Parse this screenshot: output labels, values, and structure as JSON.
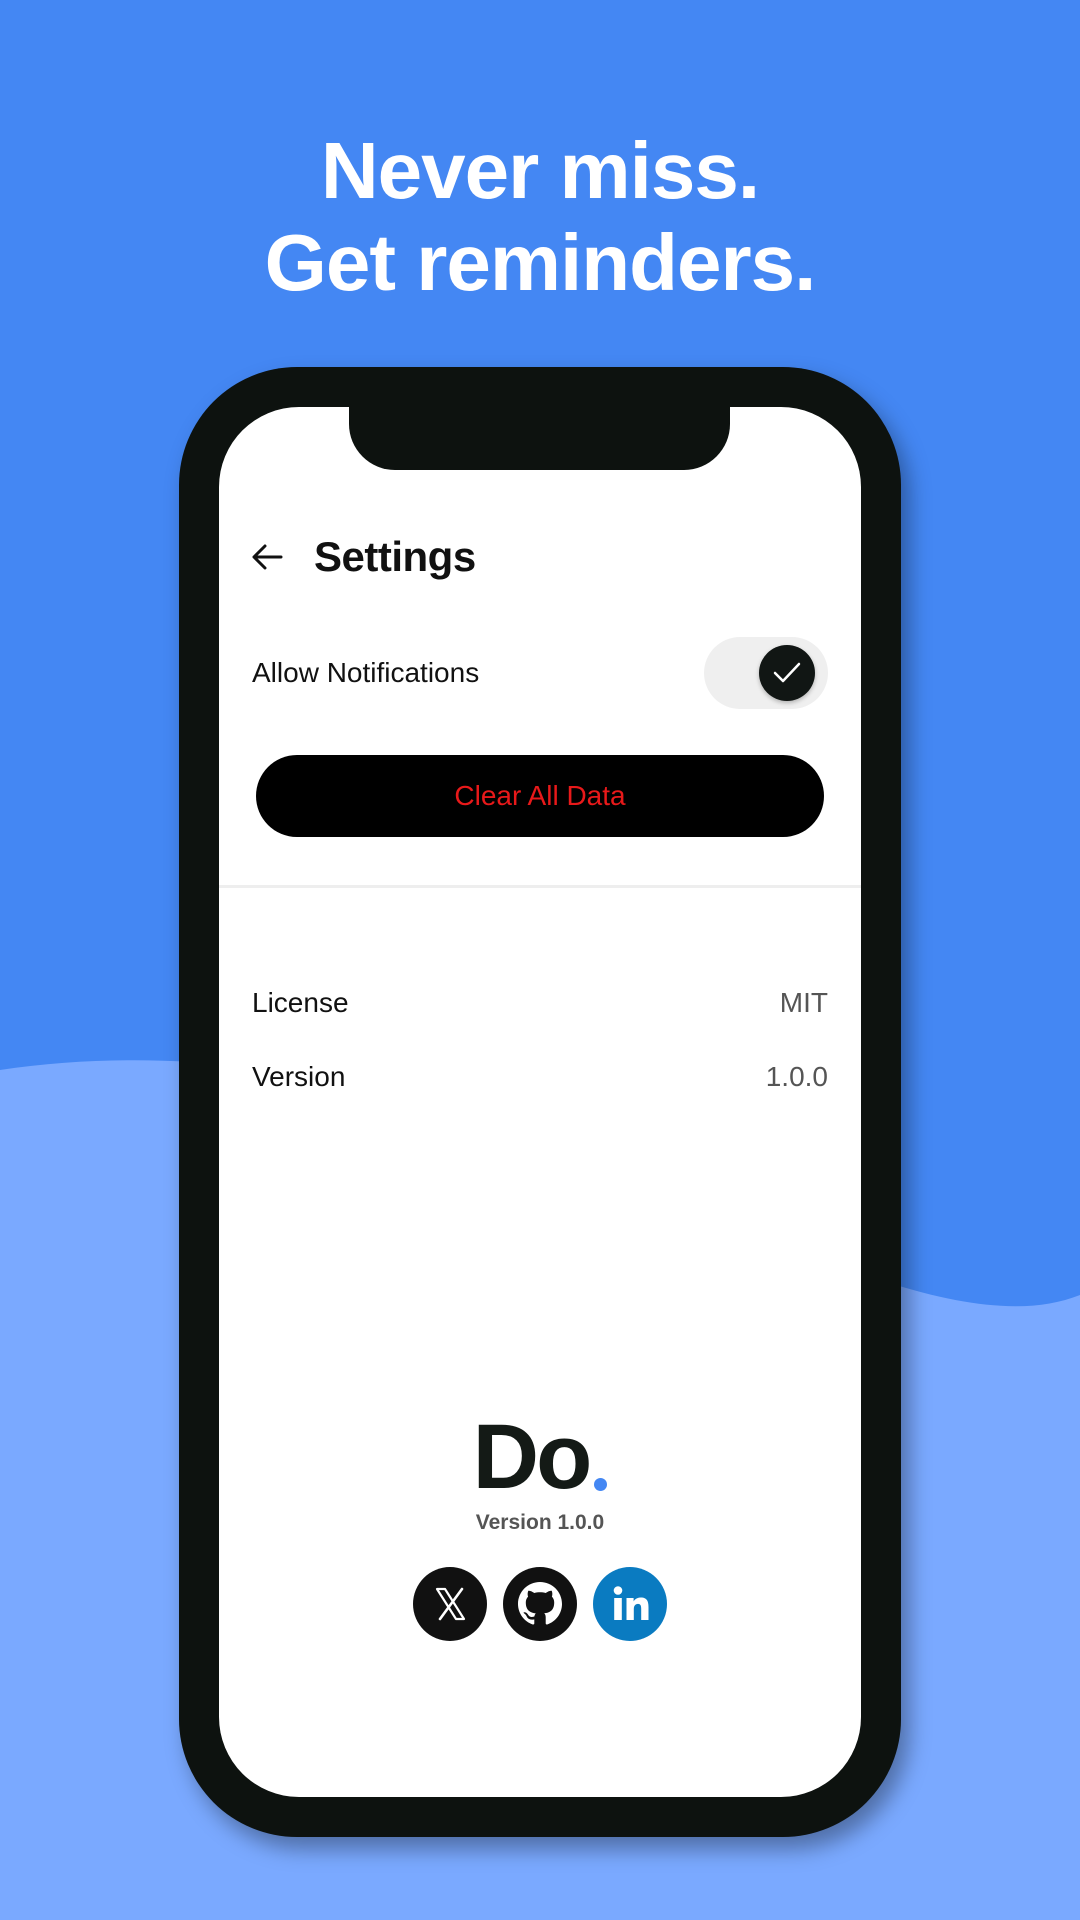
{
  "promo": {
    "headline_line1": "Never miss.",
    "headline_line2": "Get reminders."
  },
  "colors": {
    "background": "#4487F3",
    "wave": "#7AA9FF",
    "phone_frame": "#0D120F",
    "danger": "#E8191A",
    "linkedin": "#0A7BC1"
  },
  "header": {
    "back_icon": "arrow-left-icon",
    "title": "Settings"
  },
  "settings": {
    "notifications_label": "Allow Notifications",
    "notifications_enabled": true,
    "clear_button_label": "Clear All Data"
  },
  "info": [
    {
      "label": "License",
      "value": "MIT"
    },
    {
      "label": "Version",
      "value": "1.0.0"
    }
  ],
  "brand": {
    "logo_text": "Do",
    "version_text": "Version 1.0.0"
  },
  "socials": [
    {
      "name": "x",
      "icon": "x-logo-icon"
    },
    {
      "name": "github",
      "icon": "github-icon"
    },
    {
      "name": "linkedin",
      "icon": "linkedin-icon"
    }
  ]
}
